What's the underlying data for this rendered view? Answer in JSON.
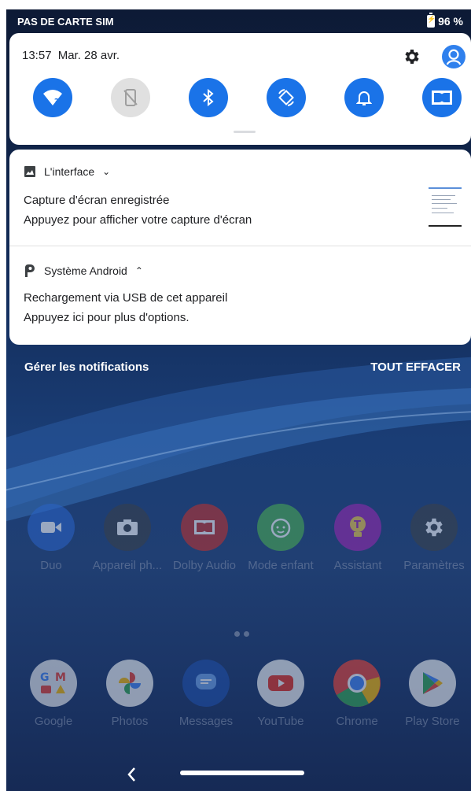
{
  "status": {
    "carrier": "PAS DE CARTE SIM",
    "battery": "96 %"
  },
  "quick_settings": {
    "time": "13:57",
    "date": "Mar. 28 avr.",
    "tiles": [
      {
        "name": "wifi-icon",
        "on": true
      },
      {
        "name": "mobile-data-off-icon",
        "on": false
      },
      {
        "name": "bluetooth-icon",
        "on": true
      },
      {
        "name": "auto-rotate-icon",
        "on": true
      },
      {
        "name": "notification-bell-icon",
        "on": true
      },
      {
        "name": "dolby-icon",
        "on": true
      }
    ]
  },
  "notifications": [
    {
      "app": "L'interface",
      "expand": "⌄",
      "title": "Capture d'écran enregistrée",
      "body": "Appuyez pour afficher votre capture d'écran"
    },
    {
      "app": "Système Android",
      "expand": "⌃",
      "title": "Rechargement via USB de cet appareil",
      "body": "Appuyez ici pour plus d'options."
    }
  ],
  "actions": {
    "manage": "Gérer les notifications",
    "clear": "TOUT EFFACER"
  },
  "apps_row1": [
    "Duo",
    "Appareil ph...",
    "Dolby Audio",
    "Mode enfant",
    "Assistant",
    "Paramètres"
  ],
  "apps_row2": [
    "Google",
    "Photos",
    "Messages",
    "YouTube",
    "Chrome",
    "Play Store"
  ],
  "colors": {
    "accent": "#1a73e8",
    "tile_off": "#e0e0e0"
  }
}
